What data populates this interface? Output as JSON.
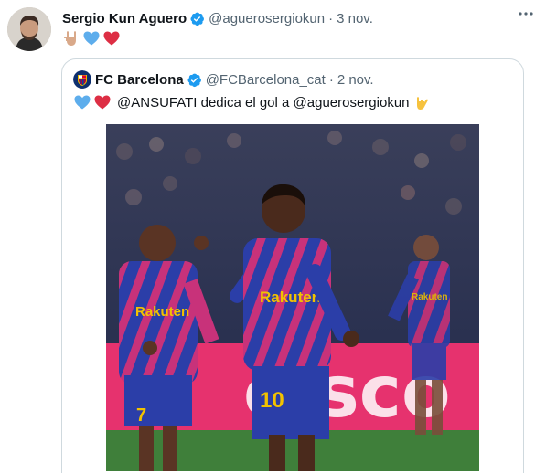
{
  "tweet": {
    "author_name": "Sergio Kun Aguero",
    "handle": "@aguerosergiokun",
    "separator": "·",
    "date": "3 nov.",
    "emojis": [
      "rock-hand-emoji",
      "blue-heart-emoji",
      "red-heart-emoji"
    ]
  },
  "quote": {
    "author_name": "FC Barcelona",
    "handle": "@FCBarcelona_cat",
    "separator": "·",
    "date": "2 nov.",
    "text": "@ANSUFATI dedica el gol a @aguerosergiokun",
    "emojis_before": [
      "blue-heart-emoji",
      "red-heart-emoji"
    ],
    "emoji_after": "call-me-hand-emoji"
  },
  "photo": {
    "sponsor_text_1": "Rakuten",
    "sponsor_text_2": "Rakuten",
    "sponsor_text_3": "Rakuten",
    "shirt_number_left": "7",
    "shirt_number_center": "10"
  },
  "colors": {
    "verified_blue": "#1d9bf0",
    "secondary_text": "#536471",
    "border": "#cfd9de",
    "barca_blue": "#2b3ea8",
    "barca_pink": "#c8327a"
  }
}
